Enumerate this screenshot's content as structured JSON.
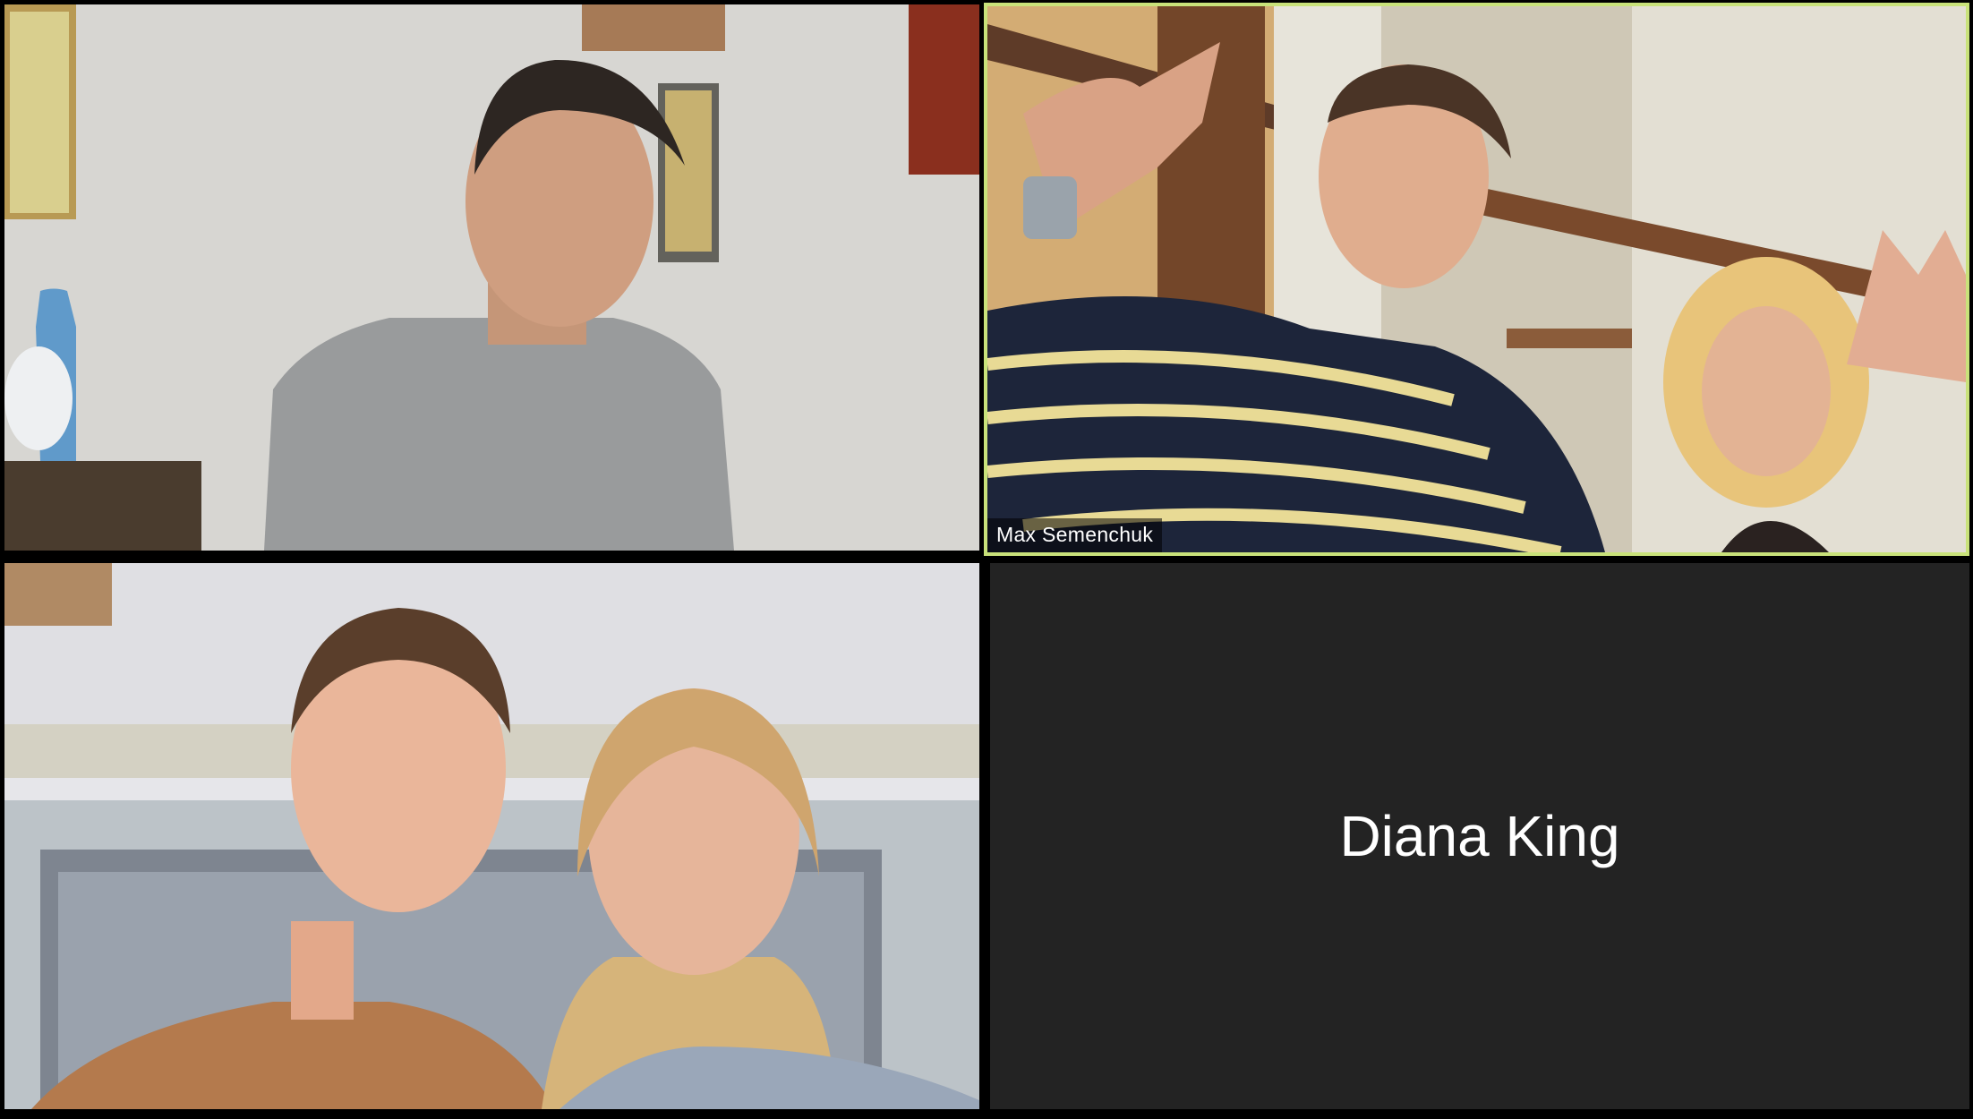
{
  "participants": [
    {
      "display_name": "",
      "video": "on"
    },
    {
      "display_name": "Max Semenchuk",
      "video": "on",
      "active_speaker": true
    },
    {
      "display_name": "",
      "video": "on"
    },
    {
      "display_name": "Diana King",
      "video": "off"
    }
  ],
  "colors": {
    "active_speaker_border": "#c9e27a",
    "video_off_background": "#232323",
    "gallery_background": "#000000"
  }
}
